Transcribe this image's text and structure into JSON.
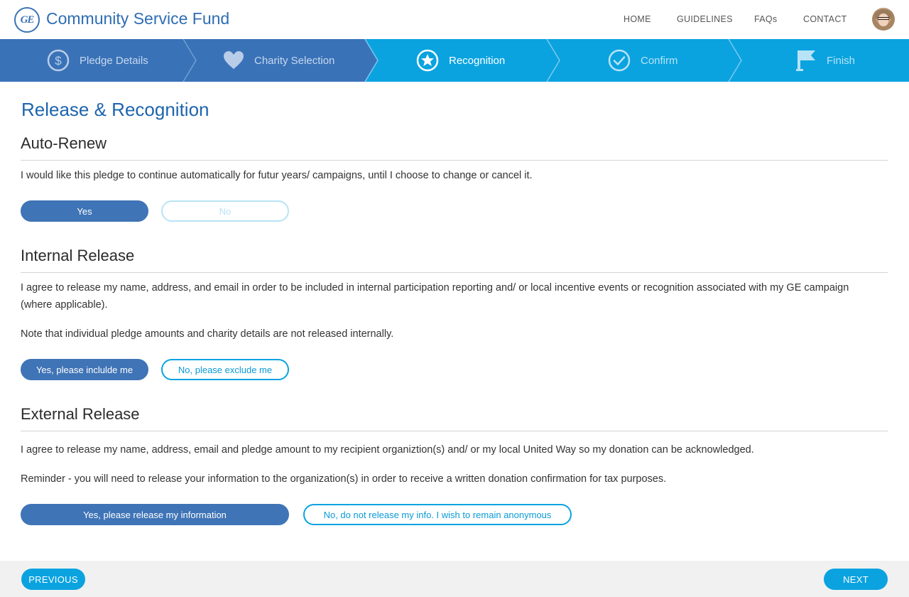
{
  "header": {
    "logo_text": "GE",
    "app_title": "Community Service Fund",
    "nav": [
      "HOME",
      "GUIDELINES",
      "FAQs",
      "CONTACT"
    ]
  },
  "steps": [
    {
      "label": "Pledge Details",
      "icon": "dollar-icon",
      "state": "done"
    },
    {
      "label": "Charity Selection",
      "icon": "heart-icon",
      "state": "done"
    },
    {
      "label": "Recognition",
      "icon": "star-icon",
      "state": "active"
    },
    {
      "label": "Confirm",
      "icon": "check-icon",
      "state": "future"
    },
    {
      "label": "Finish",
      "icon": "flag-icon",
      "state": "future"
    }
  ],
  "page_title": "Release & Recognition",
  "sections": {
    "auto_renew": {
      "title": "Auto-Renew",
      "text": "I would like this pledge to continue automatically for futur years/ campaigns, until I choose to change or cancel it.",
      "yes_label": "Yes",
      "no_label": "No",
      "selected": "Yes"
    },
    "internal_release": {
      "title": "Internal Release",
      "text": "I agree to release my name, address, and email in order to be included in internal participation reporting and/ or local incentive events or recognition associated with my GE campaign (where applicable).",
      "note": "Note that individual pledge amounts and charity details are not released internally.",
      "yes_label": "Yes, please inclulde me",
      "no_label": "No, please exclude me",
      "selected": "Yes, please inclulde me"
    },
    "external_release": {
      "title": "External Release",
      "text": "I agree to release my name, address, email and pledge amount to my recipient organiztion(s) and/ or my local United Way so my donation can be acknowledged.",
      "note": "Reminder - you will need to release your information to the organization(s) in order to receive a written donation confirmation for tax purposes.",
      "yes_label": "Yes, please release my information",
      "no_label": "No, do not release my info. I wish to remain anonymous",
      "selected": "Yes, please release my information"
    }
  },
  "footer": {
    "previous_label": "PREVIOUS",
    "next_label": "NEXT"
  },
  "colors": {
    "brand_blue": "#2f6db3",
    "steps_bg": "#0aa3e0",
    "steps_done_bg": "#3a72b8",
    "button_fill": "#3f74b6"
  }
}
